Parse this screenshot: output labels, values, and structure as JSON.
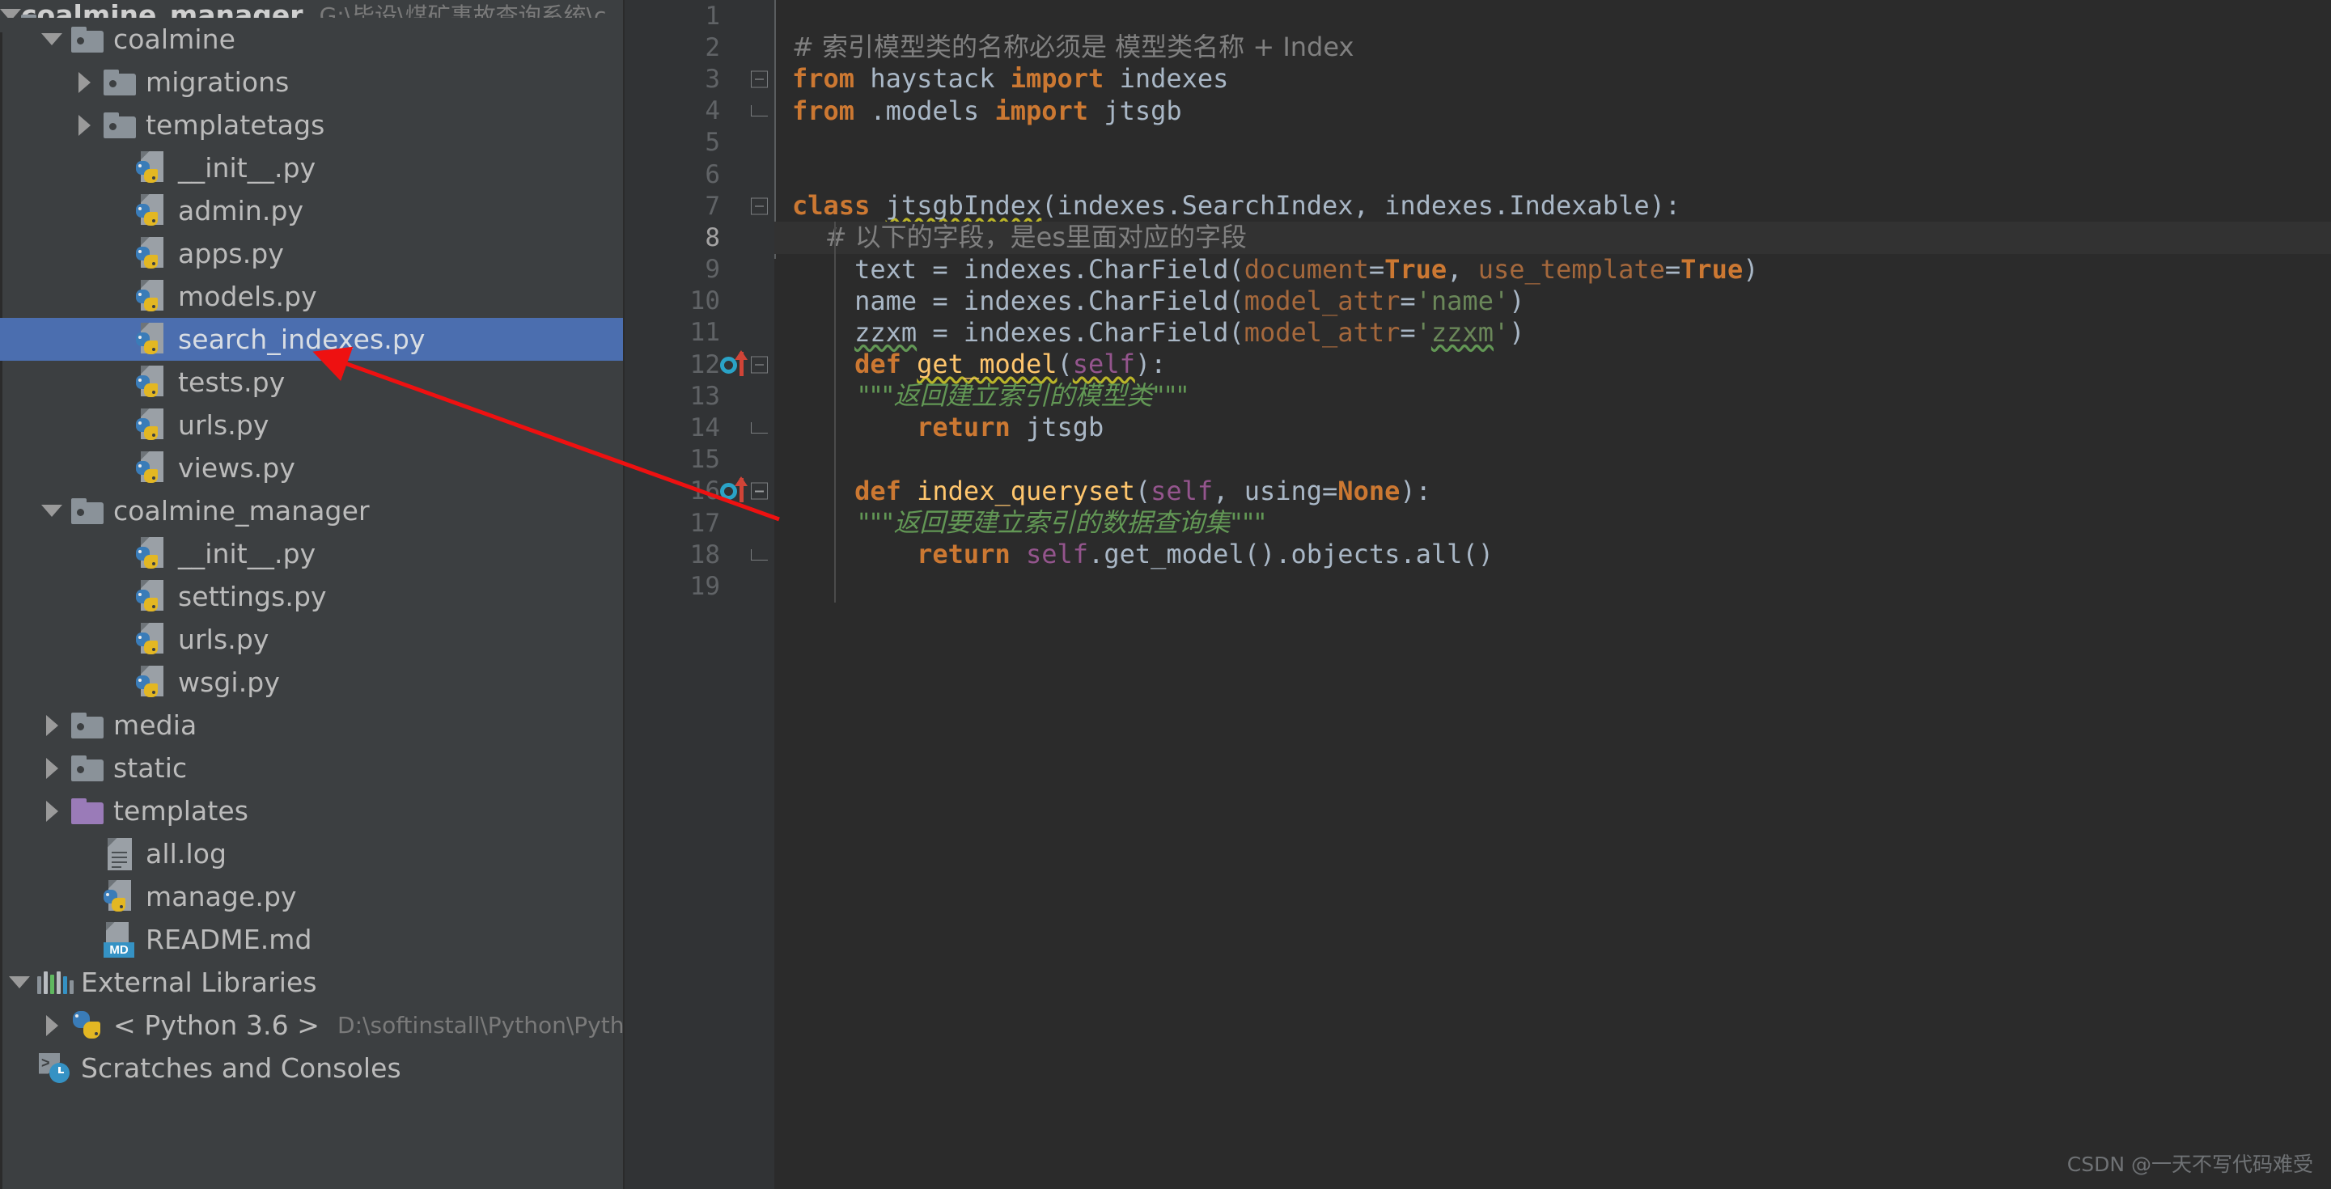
{
  "window": {
    "app": "PyCharm",
    "theme": "Darcula"
  },
  "sidebar": {
    "top_partial_row": {
      "label": "coalmine_manager",
      "path_hint": "G:\\毕设\\煤矿事故查询系统\\c",
      "icon": "folder-icon",
      "expanded": true
    },
    "items": [
      {
        "label": "coalmine",
        "indent": 1,
        "icon": "folder-icon",
        "toggle": "down",
        "selected": false
      },
      {
        "label": "migrations",
        "indent": 2,
        "icon": "folder-icon",
        "toggle": "right",
        "selected": false
      },
      {
        "label": "templatetags",
        "indent": 2,
        "icon": "folder-icon",
        "toggle": "right",
        "selected": false
      },
      {
        "label": "__init__.py",
        "indent": 3,
        "icon": "python-file-icon",
        "toggle": "none",
        "selected": false
      },
      {
        "label": "admin.py",
        "indent": 3,
        "icon": "python-file-icon",
        "toggle": "none",
        "selected": false
      },
      {
        "label": "apps.py",
        "indent": 3,
        "icon": "python-file-icon",
        "toggle": "none",
        "selected": false
      },
      {
        "label": "models.py",
        "indent": 3,
        "icon": "python-file-icon",
        "toggle": "none",
        "selected": false
      },
      {
        "label": "search_indexes.py",
        "indent": 3,
        "icon": "python-file-icon",
        "toggle": "none",
        "selected": true
      },
      {
        "label": "tests.py",
        "indent": 3,
        "icon": "python-file-icon",
        "toggle": "none",
        "selected": false
      },
      {
        "label": "urls.py",
        "indent": 3,
        "icon": "python-file-icon",
        "toggle": "none",
        "selected": false
      },
      {
        "label": "views.py",
        "indent": 3,
        "icon": "python-file-icon",
        "toggle": "none",
        "selected": false
      },
      {
        "label": "coalmine_manager",
        "indent": 1,
        "icon": "folder-icon",
        "toggle": "down",
        "selected": false
      },
      {
        "label": "__init__.py",
        "indent": 3,
        "icon": "python-file-icon",
        "toggle": "none",
        "selected": false
      },
      {
        "label": "settings.py",
        "indent": 3,
        "icon": "python-file-icon",
        "toggle": "none",
        "selected": false
      },
      {
        "label": "urls.py",
        "indent": 3,
        "icon": "python-file-icon",
        "toggle": "none",
        "selected": false
      },
      {
        "label": "wsgi.py",
        "indent": 3,
        "icon": "python-file-icon",
        "toggle": "none",
        "selected": false
      },
      {
        "label": "media",
        "indent": 1,
        "icon": "folder-icon",
        "toggle": "right",
        "selected": false
      },
      {
        "label": "static",
        "indent": 1,
        "icon": "folder-icon",
        "toggle": "right",
        "selected": false
      },
      {
        "label": "templates",
        "indent": 1,
        "icon": "folder-icon-purple",
        "toggle": "right",
        "selected": false
      },
      {
        "label": "all.log",
        "indent": 2,
        "icon": "log-file-icon",
        "toggle": "none",
        "selected": false
      },
      {
        "label": "manage.py",
        "indent": 2,
        "icon": "python-file-icon",
        "toggle": "none",
        "selected": false
      },
      {
        "label": "README.md",
        "indent": 2,
        "icon": "markdown-file-icon",
        "toggle": "none",
        "selected": false
      },
      {
        "label": "External Libraries",
        "indent": 0,
        "icon": "libraries-icon",
        "toggle": "down",
        "selected": false
      },
      {
        "label": "< Python 3.6 >",
        "indent": 1,
        "icon": "python-logo-icon",
        "toggle": "right",
        "selected": false,
        "sublabel": "D:\\softinstall\\Python\\Pythor"
      },
      {
        "label": "Scratches and Consoles",
        "indent": 0,
        "icon": "scratches-icon",
        "toggle": "none",
        "selected": false
      }
    ]
  },
  "editor": {
    "file": "search_indexes.py",
    "current_line": 8,
    "lines": [
      {
        "n": "1",
        "fold": "none",
        "gutter": "none",
        "tokens": []
      },
      {
        "n": "2",
        "fold": "none",
        "gutter": "none",
        "tokens": [
          {
            "t": "# 索引模型类的名称必须是 模型类名称 + Index",
            "c": "cmt",
            "cjk": true
          }
        ]
      },
      {
        "n": "3",
        "fold": "start",
        "gutter": "none",
        "tokens": [
          {
            "t": "from ",
            "c": "kw"
          },
          {
            "t": "haystack ",
            "c": "plain"
          },
          {
            "t": "import ",
            "c": "kw"
          },
          {
            "t": "indexes",
            "c": "plain"
          }
        ]
      },
      {
        "n": "4",
        "fold": "end",
        "gutter": "none",
        "tokens": [
          {
            "t": "from ",
            "c": "kw"
          },
          {
            "t": ".models ",
            "c": "plain"
          },
          {
            "t": "import ",
            "c": "kw"
          },
          {
            "t": "jtsgb",
            "c": "plain"
          }
        ]
      },
      {
        "n": "5",
        "fold": "none",
        "gutter": "none",
        "tokens": []
      },
      {
        "n": "6",
        "fold": "none",
        "gutter": "none",
        "tokens": []
      },
      {
        "n": "7",
        "fold": "start",
        "gutter": "none",
        "tokens": [
          {
            "t": "class ",
            "c": "kw"
          },
          {
            "t": "jtsgbIndex",
            "c": "plain",
            "squiggle": "yellow"
          },
          {
            "t": "(indexes.SearchIndex, indexes.Indexable):",
            "c": "plain"
          }
        ]
      },
      {
        "n": "8",
        "fold": "none",
        "gutter": "none",
        "current": true,
        "tokens": [
          {
            "t": "    # 以下的字段，是es里面对应的字段",
            "c": "cmt",
            "cjk": true
          }
        ]
      },
      {
        "n": "9",
        "fold": "none",
        "gutter": "none",
        "tokens": [
          {
            "t": "    text = indexes.CharField(",
            "c": "plain"
          },
          {
            "t": "document",
            "c": "kwarg"
          },
          {
            "t": "=",
            "c": "plain"
          },
          {
            "t": "True",
            "c": "kw"
          },
          {
            "t": ", ",
            "c": "plain"
          },
          {
            "t": "use_template",
            "c": "kwarg"
          },
          {
            "t": "=",
            "c": "plain"
          },
          {
            "t": "True",
            "c": "kw"
          },
          {
            "t": ")",
            "c": "plain"
          }
        ]
      },
      {
        "n": "10",
        "fold": "none",
        "gutter": "none",
        "tokens": [
          {
            "t": "    name = indexes.CharField(",
            "c": "plain"
          },
          {
            "t": "model_attr",
            "c": "kwarg"
          },
          {
            "t": "=",
            "c": "plain"
          },
          {
            "t": "'name'",
            "c": "str"
          },
          {
            "t": ")",
            "c": "plain"
          }
        ]
      },
      {
        "n": "11",
        "fold": "none",
        "gutter": "none",
        "tokens": [
          {
            "t": "    ",
            "c": "plain"
          },
          {
            "t": "zzxm",
            "c": "plain",
            "squiggle": "green"
          },
          {
            "t": " = indexes.CharField(",
            "c": "plain"
          },
          {
            "t": "model_attr",
            "c": "kwarg"
          },
          {
            "t": "=",
            "c": "plain"
          },
          {
            "t": "'",
            "c": "str"
          },
          {
            "t": "zzxm",
            "c": "str",
            "squiggle": "green"
          },
          {
            "t": "'",
            "c": "str"
          },
          {
            "t": ")",
            "c": "plain"
          }
        ]
      },
      {
        "n": "12",
        "fold": "start",
        "gutter": "override",
        "tokens": [
          {
            "t": "    ",
            "c": "plain"
          },
          {
            "t": "def ",
            "c": "kw"
          },
          {
            "t": "get_model",
            "c": "fn",
            "squiggle": "yellow"
          },
          {
            "t": "(",
            "c": "plain"
          },
          {
            "t": "self",
            "c": "self",
            "squiggle": "yellow"
          },
          {
            "t": "):",
            "c": "plain"
          }
        ]
      },
      {
        "n": "13",
        "fold": "none",
        "gutter": "none",
        "tokens": [
          {
            "t": "        \"\"\"返回建立索引的模型类\"\"\"",
            "c": "doc",
            "cjk": true
          }
        ]
      },
      {
        "n": "14",
        "fold": "end",
        "gutter": "none",
        "tokens": [
          {
            "t": "        ",
            "c": "plain"
          },
          {
            "t": "return ",
            "c": "kw"
          },
          {
            "t": "jtsgb",
            "c": "plain"
          }
        ]
      },
      {
        "n": "15",
        "fold": "none",
        "gutter": "none",
        "tokens": []
      },
      {
        "n": "16",
        "fold": "start",
        "gutter": "override",
        "tokens": [
          {
            "t": "    ",
            "c": "plain"
          },
          {
            "t": "def ",
            "c": "kw"
          },
          {
            "t": "index_queryset",
            "c": "fn"
          },
          {
            "t": "(",
            "c": "plain"
          },
          {
            "t": "self",
            "c": "self"
          },
          {
            "t": ", using=",
            "c": "plain"
          },
          {
            "t": "None",
            "c": "kw"
          },
          {
            "t": "):",
            "c": "plain"
          }
        ]
      },
      {
        "n": "17",
        "fold": "none",
        "gutter": "none",
        "tokens": [
          {
            "t": "        \"\"\"返回要建立索引的数据查询集\"\"\"",
            "c": "doc",
            "cjk": true
          }
        ]
      },
      {
        "n": "18",
        "fold": "end",
        "gutter": "none",
        "tokens": [
          {
            "t": "        ",
            "c": "plain"
          },
          {
            "t": "return ",
            "c": "kw"
          },
          {
            "t": "self",
            "c": "self"
          },
          {
            "t": ".get_model().objects.all()",
            "c": "plain"
          }
        ]
      },
      {
        "n": "19",
        "fold": "none",
        "gutter": "none",
        "tokens": []
      }
    ]
  },
  "annotation": {
    "type": "arrow",
    "color": "#ee1111",
    "from_label": "search_indexes.py",
    "to_label": "code editor"
  },
  "watermark": {
    "text": "CSDN @一天不写代码难受"
  },
  "colors": {
    "sidebar_bg": "#3c3f41",
    "editor_bg": "#2b2b2b",
    "gutter_bg": "#313335",
    "selection": "#4b6eaf",
    "current_line": "#323232",
    "keyword": "#cc7832",
    "string": "#6a8759",
    "docstring": "#629755",
    "comment": "#808080",
    "function": "#ffc66d",
    "self": "#94558d",
    "kwarg": "#a5683c",
    "text": "#a9b7c6",
    "annotation": "#ee1111"
  }
}
